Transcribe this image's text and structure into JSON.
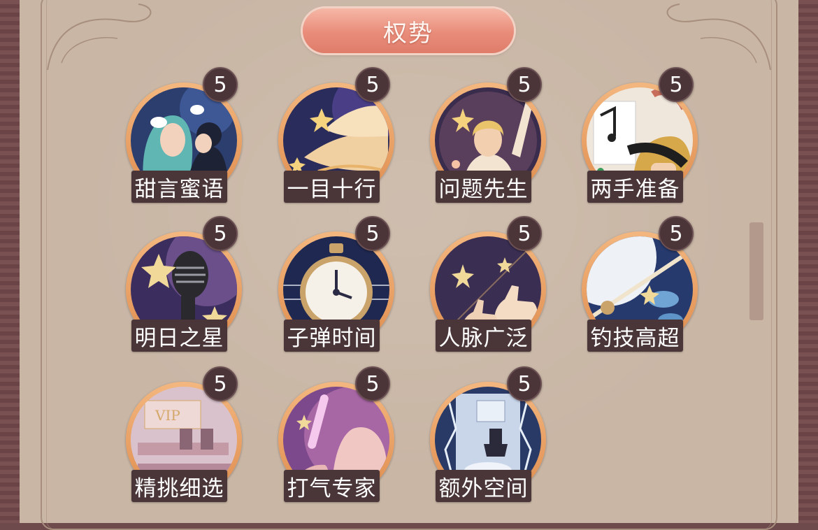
{
  "panel": {
    "title": "权势"
  },
  "skills": [
    {
      "name": "甜言蜜语",
      "level": "5",
      "icon": "couple-whisper-icon"
    },
    {
      "name": "一目十行",
      "level": "5",
      "icon": "flying-pages-icon"
    },
    {
      "name": "问题先生",
      "level": "5",
      "icon": "raised-hand-man-icon"
    },
    {
      "name": "两手准备",
      "level": "5",
      "icon": "music-note-hands-icon"
    },
    {
      "name": "明日之星",
      "level": "5",
      "icon": "microphone-stars-icon"
    },
    {
      "name": "子弹时间",
      "level": "5",
      "icon": "stopwatch-icon"
    },
    {
      "name": "人脉广泛",
      "level": "5",
      "icon": "thumbs-up-icon"
    },
    {
      "name": "钓技高超",
      "level": "5",
      "icon": "fishing-rod-icon"
    },
    {
      "name": "精挑细选",
      "level": "5",
      "icon": "vip-seats-icon"
    },
    {
      "name": "打气专家",
      "level": "5",
      "icon": "glowstick-fist-icon"
    },
    {
      "name": "额外空间",
      "level": "5",
      "icon": "extra-room-icon"
    }
  ],
  "colors": {
    "title_banner": "#e98c7a",
    "label_bg": "#4a3638",
    "badge_bg": "#4c3538",
    "medal_ring": "#e8a066",
    "panel_bg": "#c9b6a5"
  }
}
